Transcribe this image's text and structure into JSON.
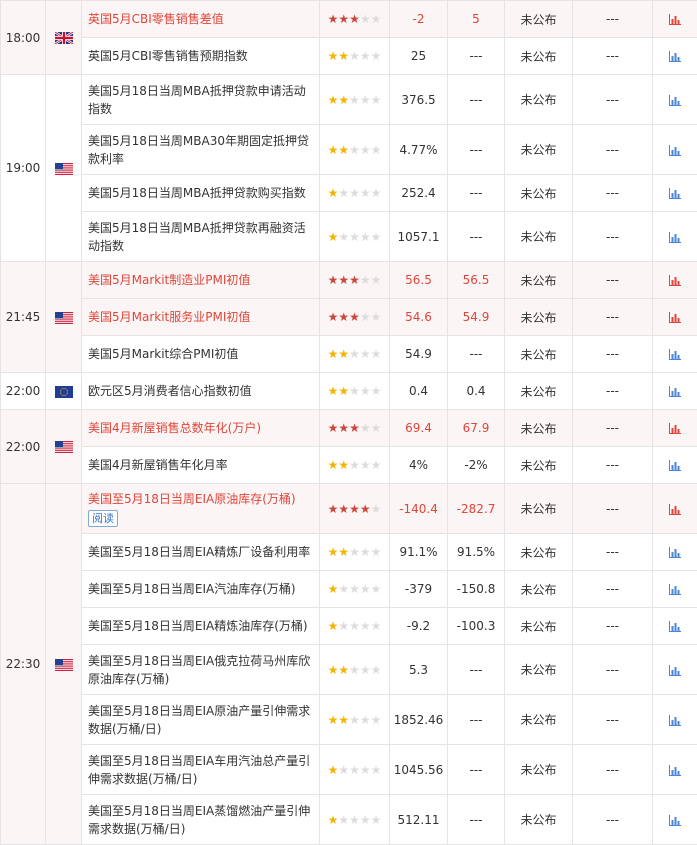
{
  "rows": [
    {
      "time": "18:00",
      "flag": "uk-flag",
      "name": "英国5月CBI零售销售差值",
      "stars": 3,
      "important": true,
      "prev": "-2",
      "forecast": "5",
      "actual": "未公布",
      "extra": "---"
    },
    {
      "name": "英国5月CBI零售销售预期指数",
      "stars": 2,
      "important": false,
      "prev": "25",
      "forecast": "---",
      "actual": "未公布",
      "extra": "---"
    },
    {
      "time": "19:00",
      "flag": "us-flag",
      "name": "美国5月18日当周MBA抵押贷款申请活动指数",
      "stars": 2,
      "important": false,
      "prev": "376.5",
      "forecast": "---",
      "actual": "未公布",
      "extra": "---"
    },
    {
      "name": "美国5月18日当周MBA30年期固定抵押贷款利率",
      "stars": 2,
      "important": false,
      "prev": "4.77%",
      "forecast": "---",
      "actual": "未公布",
      "extra": "---"
    },
    {
      "name": "美国5月18日当周MBA抵押贷款购买指数",
      "stars": 1,
      "important": false,
      "prev": "252.4",
      "forecast": "---",
      "actual": "未公布",
      "extra": "---"
    },
    {
      "name": "美国5月18日当周MBA抵押贷款再融资活动指数",
      "stars": 1,
      "important": false,
      "prev": "1057.1",
      "forecast": "---",
      "actual": "未公布",
      "extra": "---"
    },
    {
      "time": "21:45",
      "flag": "us-flag",
      "name": "美国5月Markit制造业PMI初值",
      "stars": 3,
      "important": true,
      "prev": "56.5",
      "forecast": "56.5",
      "actual": "未公布",
      "extra": "---"
    },
    {
      "name": "美国5月Markit服务业PMI初值",
      "stars": 3,
      "important": true,
      "prev": "54.6",
      "forecast": "54.9",
      "actual": "未公布",
      "extra": "---"
    },
    {
      "name": "美国5月Markit综合PMI初值",
      "stars": 2,
      "important": false,
      "prev": "54.9",
      "forecast": "---",
      "actual": "未公布",
      "extra": "---"
    },
    {
      "time": "22:00",
      "flag": "eu-flag",
      "name": "欧元区5月消费者信心指数初值",
      "stars": 2,
      "important": false,
      "prev": "0.4",
      "forecast": "0.4",
      "actual": "未公布",
      "extra": "---"
    },
    {
      "time": "22:00",
      "flag": "us-flag",
      "name": "美国4月新屋销售总数年化(万户)",
      "stars": 3,
      "important": true,
      "prev": "69.4",
      "forecast": "67.9",
      "actual": "未公布",
      "extra": "---"
    },
    {
      "name": "美国4月新屋销售年化月率",
      "stars": 2,
      "important": false,
      "prev": "4%",
      "forecast": "-2%",
      "actual": "未公布",
      "extra": "---"
    },
    {
      "time": "22:30",
      "flag": "us-flag",
      "name": "美国至5月18日当周EIA原油库存(万桶)",
      "stars": 4,
      "important": true,
      "read": "阅读",
      "prev": "-140.4",
      "forecast": "-282.7",
      "actual": "未公布",
      "extra": "---"
    },
    {
      "name": "美国至5月18日当周EIA精炼厂设备利用率",
      "stars": 2,
      "important": false,
      "prev": "91.1%",
      "forecast": "91.5%",
      "actual": "未公布",
      "extra": "---"
    },
    {
      "name": "美国至5月18日当周EIA汽油库存(万桶)",
      "stars": 1,
      "important": false,
      "prev": "-379",
      "forecast": "-150.8",
      "actual": "未公布",
      "extra": "---"
    },
    {
      "name": "美国至5月18日当周EIA精炼油库存(万桶)",
      "stars": 1,
      "important": false,
      "prev": "-9.2",
      "forecast": "-100.3",
      "actual": "未公布",
      "extra": "---"
    },
    {
      "name": "美国至5月18日当周EIA俄克拉荷马州库欣原油库存(万桶)",
      "stars": 2,
      "important": false,
      "prev": "5.3",
      "forecast": "---",
      "actual": "未公布",
      "extra": "---"
    },
    {
      "name": "美国至5月18日当周EIA原油产量引伸需求数据(万桶/日)",
      "stars": 2,
      "important": false,
      "prev": "1852.46",
      "forecast": "---",
      "actual": "未公布",
      "extra": "---"
    },
    {
      "name": "美国至5月18日当周EIA车用汽油总产量引伸需求数据(万桶/日)",
      "stars": 1,
      "important": false,
      "prev": "1045.56",
      "forecast": "---",
      "actual": "未公布",
      "extra": "---"
    },
    {
      "name": "美国至5月18日当周EIA蒸馏燃油产量引伸需求数据(万桶/日)",
      "stars": 1,
      "important": false,
      "prev": "512.11",
      "forecast": "---",
      "actual": "未公布",
      "extra": "---"
    }
  ],
  "colors": {
    "important_text": "#e0453a",
    "important_bg": "#fbf6f5",
    "chart_red": "#e0453a",
    "chart_blue": "#4a86d8",
    "star_gold": "#f4b400",
    "star_red": "#c9473b",
    "star_grey": "#dcdcdc"
  }
}
